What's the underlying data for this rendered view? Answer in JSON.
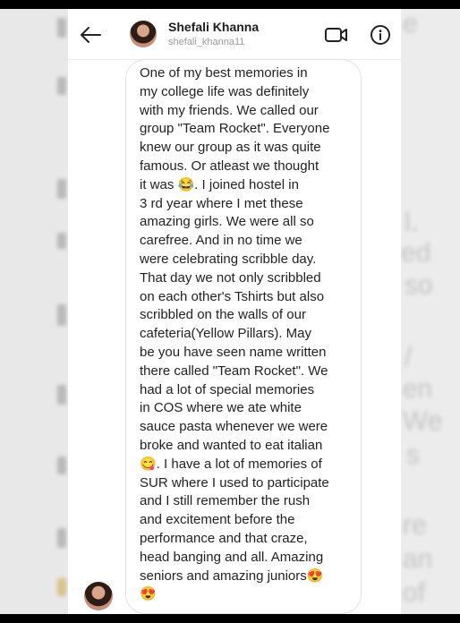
{
  "header": {
    "name": "Shefali Khanna",
    "username": "shefali_khanna11"
  },
  "message": {
    "text": "One of my best memories in\nmy college life was definitely\nwith my friends. We called our\ngroup \"Team Rocket\". Everyone\nknew our group as it was quite\nfamous. Or atleast we thought\nit was 😂. I joined hostel in\n3 rd year where I met these\namazing girls. We were all so\ncarefree. And in no time we\nwere celebrating scribble day.\nThat day we not only scribbled\non each other's Tshirts but also\nscribbled on the walls of our\ncafeteria(Yellow Pillars). May\nbe you have seen name written\nthere called \"Team Rocket\". We\nhad a lot of special memories\nin COS where we ate white\nsauce pasta whenever we were\nbroke and wanted to eat italian\n😋. I have a lot of memories of\nSUR where I used to participate\nand I still remember the rush\nand excitement before the\nperformance and that craze,\nhead banging and all. Amazing\nseniors and amazing juniors😍\n😍"
  },
  "background_right": [
    "e",
    "l.",
    "ed",
    "so",
    "/",
    "en",
    "We",
    "s",
    "re",
    "an",
    "of"
  ],
  "colors": {
    "text": "#222222",
    "muted": "#9a9a9a",
    "bubble_border": "#e2e2e2",
    "background_blur": "#e8e8e8"
  },
  "icons": {
    "back": "arrow-left-icon",
    "video": "video-camera-icon",
    "info": "info-icon",
    "avatar": "profile-photo"
  }
}
